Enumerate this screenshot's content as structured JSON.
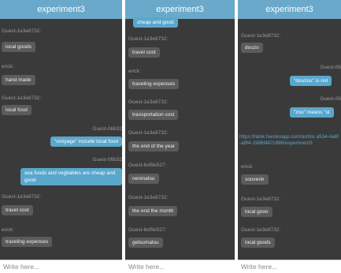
{
  "panels": [
    {
      "title": "experiment3",
      "input_placeholder": "Write here...",
      "messages": [
        {
          "sender": "Guest-1e3e8732:",
          "text": "local goods"
        },
        {
          "sender": "erick:",
          "text": "hand made"
        },
        {
          "sender": "Guest-1e3e8732:",
          "text": "local food"
        },
        {
          "sender": "Guest-06b32",
          "text": "\"omiyage\" include local food"
        },
        {
          "sender": "Guest-06b32",
          "text": "sea foods and vegitables are cheap and good"
        },
        {
          "sender": "Guest-1e3e8732:",
          "text": "travel cost"
        },
        {
          "sender": "erick:",
          "text": "traveling expenses"
        }
      ]
    },
    {
      "title": "experiment3",
      "input_placeholder": "Write here...",
      "messages": [
        {
          "sender": "",
          "text": "cheap and good"
        },
        {
          "sender": "Guest-1e3e8732:",
          "text": "travel cost"
        },
        {
          "sender": "erick:",
          "text": "traveling expenses"
        },
        {
          "sender": "Guest-1e3e8732:",
          "text": "transportation cost"
        },
        {
          "sender": "Guest-1e3e8732:",
          "text": "the end of the year"
        },
        {
          "sender": "Guest-6of9e527:",
          "text": "nenmatsu"
        },
        {
          "sender": "Guest-1e3e8732:",
          "text": "the end the month"
        },
        {
          "sender": "Guest-6of9e527:",
          "text": "getsumatsu"
        }
      ]
    },
    {
      "title": "experiment3",
      "input_placeholder": "Write here...",
      "messages": [
        {
          "sender": "Guest-1e3e8732:",
          "text": "douzo"
        },
        {
          "sender": "Guest-06",
          "text": "\"douzou\" is not"
        },
        {
          "sender": "Guest-06",
          "text": "\"zou\" means \"st"
        },
        {
          "sender": "",
          "text": "https://tatsk.herokuapp.com/archiv a534-4a6f-a9f4-1986f487c986/experiment3"
        },
        {
          "sender": "erick:",
          "text": "souvenir"
        },
        {
          "sender": "Guest-1e3e8732:",
          "text": "local gooo"
        },
        {
          "sender": "Guest-1e3e8732:",
          "text": "local goods"
        }
      ]
    }
  ]
}
